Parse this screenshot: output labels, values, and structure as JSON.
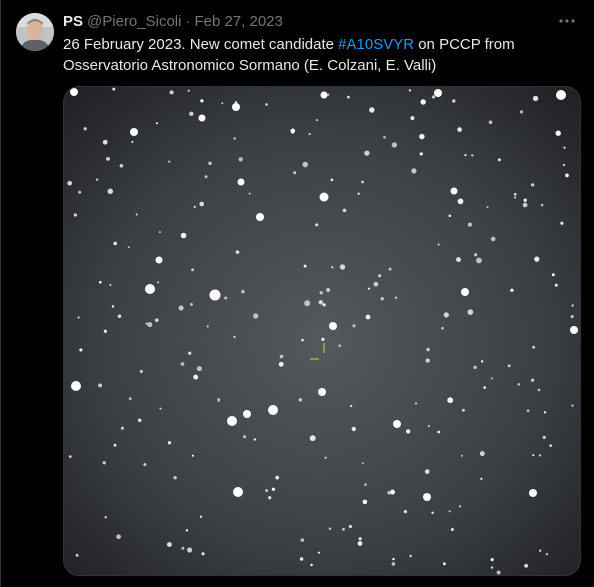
{
  "tweet": {
    "name": "PS",
    "handle": "@Piero_Sicoli",
    "separator": "·",
    "date": "Feb 27, 2023",
    "text_before": "26 February 2023. New comet candidate ",
    "hashtag": "#A10SVYR",
    "text_after": " on PCCP from Osservatorio Astronomico Sormano (E. Colzani, E. Valli)"
  },
  "icons": {
    "more": "more-horizontal-icon",
    "avatar": "user-avatar"
  },
  "colors": {
    "background": "#000000",
    "text": "#e7e9ea",
    "muted": "#71767b",
    "link": "#1d9bf0",
    "marker": "#d7d23a"
  }
}
